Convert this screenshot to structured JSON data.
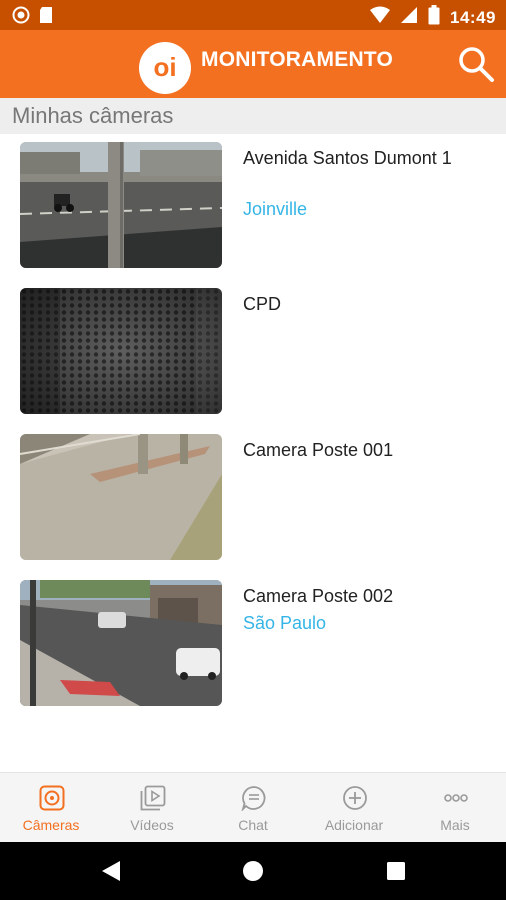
{
  "status_bar": {
    "time": "14:49",
    "left_icons": [
      "record-icon",
      "sd-card-icon"
    ],
    "right_icons": [
      "wifi-icon",
      "signal-icon",
      "battery-icon"
    ]
  },
  "app_bar": {
    "logo_text": "oi",
    "title": "MONITORAMENTO",
    "search_icon": "search-icon"
  },
  "section": {
    "title": "Minhas câmeras"
  },
  "cameras": [
    {
      "name": "Avenida Santos Dumont 1",
      "city": "Joinville"
    },
    {
      "name": "CPD",
      "city": ""
    },
    {
      "name": "Camera Poste 001",
      "city": ""
    },
    {
      "name": "Camera Poste 002",
      "city": "São Paulo"
    }
  ],
  "bottom_nav": {
    "items": [
      {
        "label": "Câmeras",
        "icon": "camera-icon",
        "active": true
      },
      {
        "label": "Vídeos",
        "icon": "video-play-icon",
        "active": false
      },
      {
        "label": "Chat",
        "icon": "chat-icon",
        "active": false
      },
      {
        "label": "Adicionar",
        "icon": "add-circle-icon",
        "active": false
      },
      {
        "label": "Mais",
        "icon": "more-dots-icon",
        "active": false
      }
    ]
  },
  "colors": {
    "brand_orange": "#f37021",
    "status_bar": "#c64f00",
    "city_link": "#35b5e6",
    "nav_inactive": "#9a9a9a"
  }
}
